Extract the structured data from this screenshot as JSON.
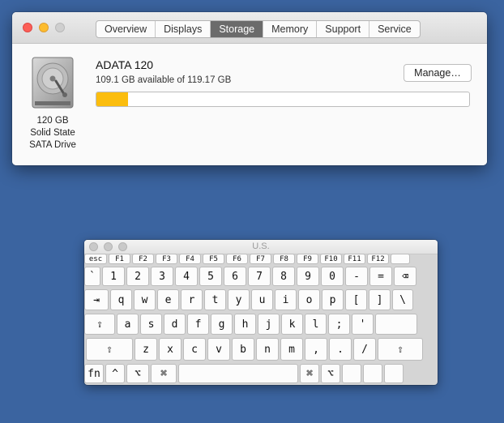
{
  "window": {
    "tabs": [
      "Overview",
      "Displays",
      "Storage",
      "Memory",
      "Support",
      "Service"
    ],
    "active_tab": "Storage"
  },
  "disk": {
    "caption_size": "120 GB",
    "caption_type": "Solid State",
    "caption_bus": "SATA Drive",
    "name": "ADATA 120",
    "available": "109.1 GB available of 119.17 GB",
    "used_fraction": 0.085,
    "bar_color": "#fbbd0e"
  },
  "manage_label": "Manage…",
  "keyboard": {
    "title": "U.S.",
    "rows": [
      [
        "esc",
        "F1",
        "F2",
        "F3",
        "F4",
        "F5",
        "F6",
        "F7",
        "F8",
        "F9",
        "F10",
        "F11",
        "F12",
        ""
      ],
      [
        "`",
        "1",
        "2",
        "3",
        "4",
        "5",
        "6",
        "7",
        "8",
        "9",
        "0",
        "-",
        "=",
        "⌫"
      ],
      [
        "⇥",
        "q",
        "w",
        "e",
        "r",
        "t",
        "y",
        "u",
        "i",
        "o",
        "p",
        "[",
        "]",
        "\\"
      ],
      [
        "⇪",
        "a",
        "s",
        "d",
        "f",
        "g",
        "h",
        "j",
        "k",
        "l",
        ";",
        "'",
        ""
      ],
      [
        "⇧",
        "z",
        "x",
        "c",
        "v",
        "b",
        "n",
        "m",
        ",",
        ".",
        "/",
        "⇧"
      ],
      [
        "fn",
        "^",
        "⌥",
        "⌘",
        "",
        "⌘",
        "⌥",
        "",
        "",
        ""
      ]
    ]
  }
}
